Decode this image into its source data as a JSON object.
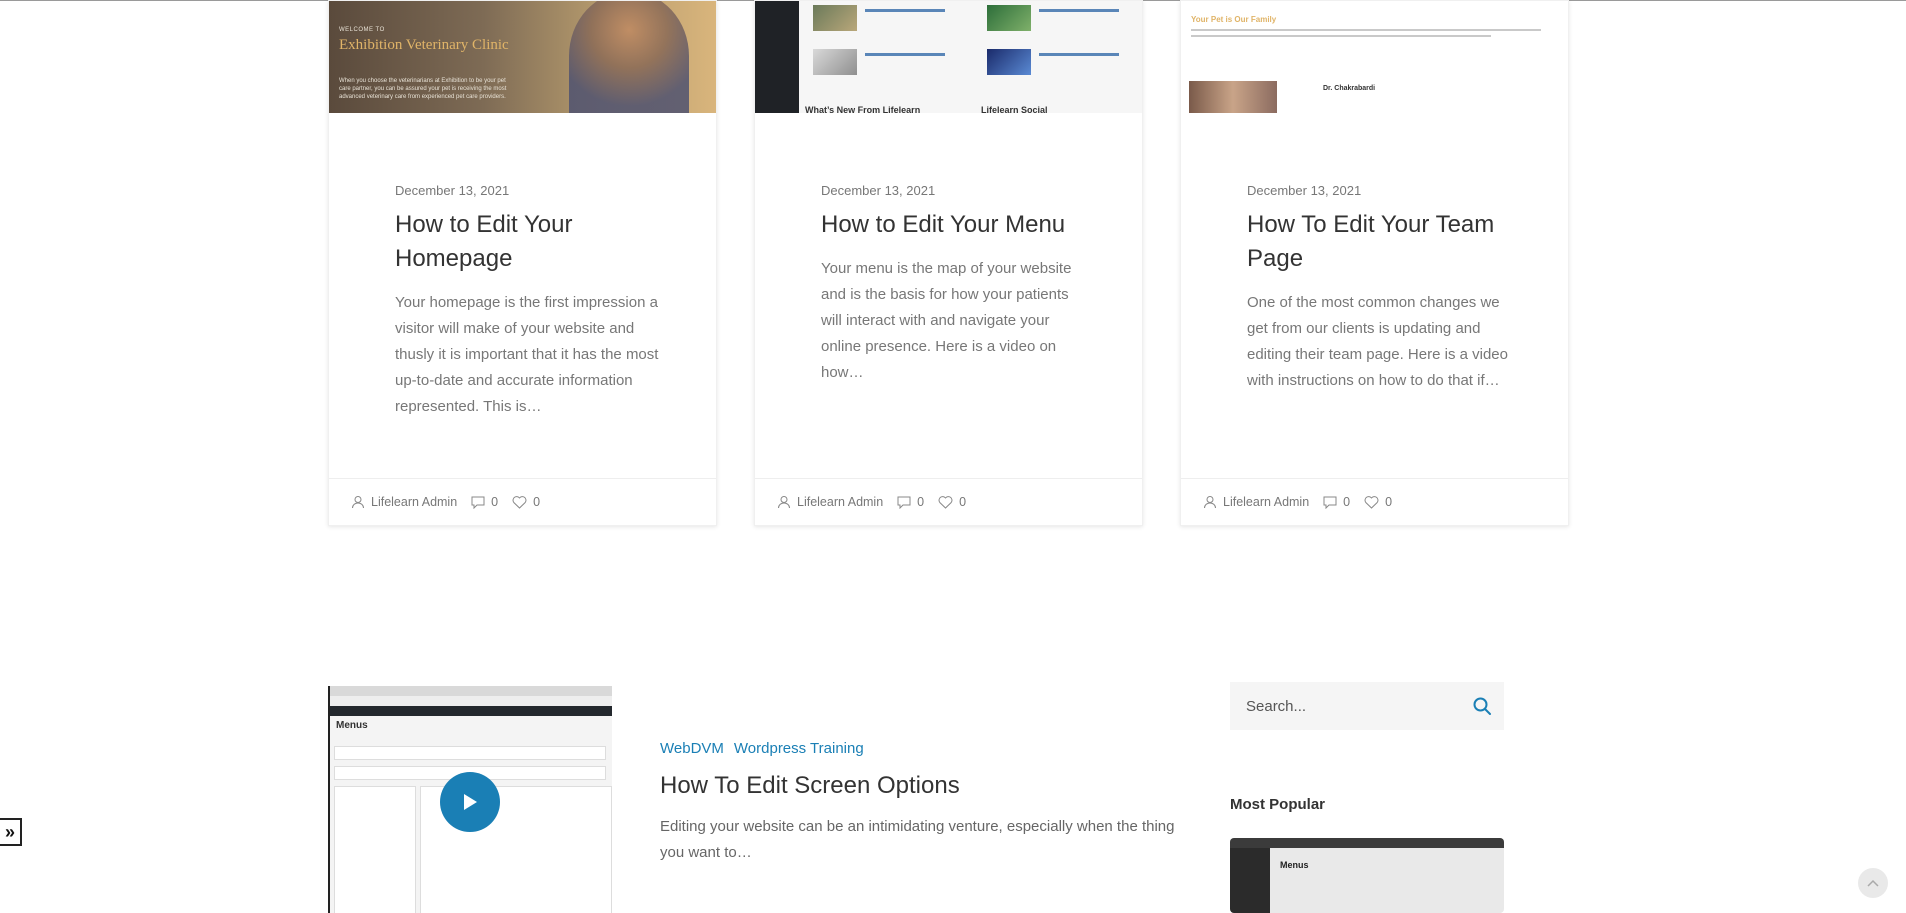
{
  "cards": [
    {
      "image": {
        "welcome": "WELCOME TO",
        "title": "Exhibition Veterinary Clinic",
        "desc": "When you choose the veterinarians at Exhibition to be your pet care partner, you can be assured your pet is receiving the most advanced veterinary care from experienced pet care providers."
      },
      "date": "December 13, 2021",
      "title": "How to Edit Your Homepage",
      "excerpt": "Your homepage is the first impression a visitor will make of your website and thusly it is important that it has the most up-to-date and accurate information represented. This is…",
      "author": "Lifelearn Admin",
      "comments": "0",
      "likes": "0"
    },
    {
      "image": {
        "bottom_left": "What’s New From Lifelearn",
        "bottom_right": "Lifelearn Social"
      },
      "date": "December 13, 2021",
      "title": "How to Edit Your Menu",
      "excerpt": "Your menu is the map of your website and is the basis for how your patients will interact with and navigate your online presence. Here is a video on how…",
      "author": "Lifelearn Admin",
      "comments": "0",
      "likes": "0"
    },
    {
      "image": {
        "heading": "Your Pet is Our Family",
        "doctor": "Dr. Chakrabardi"
      },
      "date": "December 13, 2021",
      "title": "How To Edit Your Team Page",
      "excerpt": "One of the most common changes we get from our clients is updating and editing their team page. Here is a video with instructions on how to do that if…",
      "author": "Lifelearn Admin",
      "comments": "0",
      "likes": "0"
    }
  ],
  "featured_post": {
    "categories": [
      "WebDVM",
      "Wordpress Training"
    ],
    "title": "How To Edit Screen Options",
    "excerpt": "Editing your website can be an intimidating venture, especially when the thing you want to…",
    "image_heading": "Menus"
  },
  "sidebar": {
    "search_placeholder": "Search...",
    "most_popular_title": "Most Popular",
    "popular_image_heading": "Menus"
  },
  "controls": {
    "expand_label": "»"
  },
  "colors": {
    "accent": "#1a7fb5",
    "text": "#333333",
    "muted": "#777777"
  },
  "icons": {
    "author": "user-icon",
    "comments": "comment-icon",
    "likes": "heart-icon",
    "search": "search-icon",
    "play": "play-icon",
    "top": "chevron-up-icon"
  }
}
